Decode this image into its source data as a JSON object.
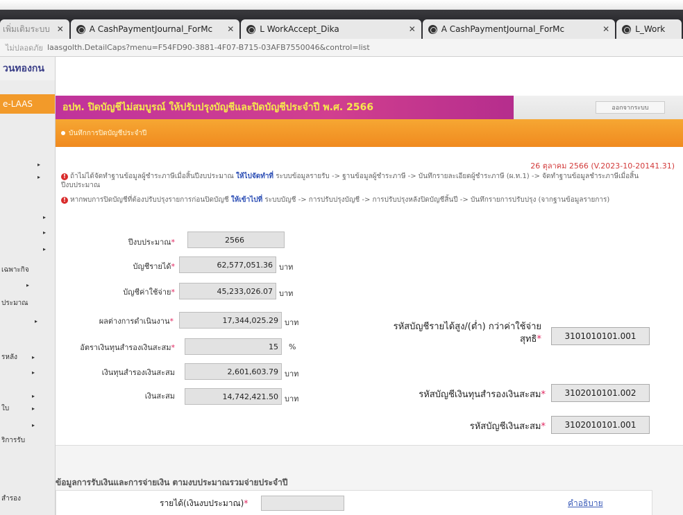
{
  "browser": {
    "tabs": [
      {
        "label": "",
        "width": 0
      },
      {
        "label": "A CashPaymentJournal_ForMc"
      },
      {
        "label": "L WorkAccept_Dika"
      },
      {
        "label": "A CashPaymentJournal_ForMc"
      },
      {
        "label": "L_Work"
      }
    ],
    "address": "laasgolth.DetailCaps?menu=F54FD90-3881-4F07-B715-03AFB7550046&control=list",
    "secure_label": "ไม่ปลอดภัย"
  },
  "sidebar": {
    "brand": "วนทองกน",
    "laas": "e-LAAS",
    "items": [
      "",
      "",
      "",
      "",
      "",
      "เฉพาะกิจ",
      "",
      "ประมาณ",
      "",
      "รหลัง",
      "",
      "",
      "ใบ",
      "",
      "ริการรับ",
      "สำรอง"
    ]
  },
  "page": {
    "title": "อปท. ปิดบัญชีไม่สมบูรณ์ ให้ปรับปรุงบัญชีและปิดบัญชีประจำปี พ.ศ. 2566",
    "back_button": "ออกจากระบบ",
    "subtitle": "บันทึกการปิดบัญชีประจำปี",
    "datestamp": "26 ตุลาคม 2566 (V.2023-10-20141.31)",
    "notice1_a": "ถ้าไม่ได้จัดทำฐานข้อมูลผู้ชำระภาษีเมื่อสิ้นปีงบประมาณ",
    "notice1_hl": "ให้ไปจัดทำที่",
    "notice1_b": "ระบบข้อมูลรายรับ -> ฐานข้อมูลผู้ชำระภาษี -> บันทึกรายละเอียดผู้ชำระภาษี (ผ.ท.1) -> จัดทำฐานข้อมูลชำระภาษีเมื่อสิ้นปีงบประมาณ",
    "notice2_a": "หากพบการปิดบัญชีที่ต้องปรับปรุงรายการก่อนปิดบัญชี",
    "notice2_hl": "ให้เข้าไปที่",
    "notice2_b": "ระบบบัญชี -> การปรับปรุงบัญชี -> การปรับปรุงหลังปิดบัญชีสิ้นปี -> บันทึกรายการปรับปรุง (จากฐานข้อมูลรายการ)",
    "unit_baht": "บาท",
    "unit_percent": "%"
  },
  "form": {
    "fiscal_year_label": "ปีงบประมาณ",
    "fiscal_year": "2566",
    "income_label": "บัญชีรายได้",
    "income": "62,577,051.36",
    "expense_label": "บัญชีค่าใช้จ่าย",
    "expense": "45,233,026.07",
    "diff_label": "ผลต่างการดำเนินงาน",
    "diff": "17,344,025.29",
    "rate_label": "อัตราเงินทุนสำรองเงินสะสม",
    "rate": "15",
    "reserve_label": "เงินทุนสำรองเงินสะสม",
    "reserve": "2,601,603.79",
    "accum_label": "เงินสะสม",
    "accum": "14,742,421.50"
  },
  "accounts": {
    "net_label_1": "รหัสบัญชีรายได้สูง/(ต่ำ) กว่าค่าใช้จ่าย",
    "net_label_2": "สุทธิ",
    "net_code": "3101010101.001",
    "reserve_label": "รหัสบัญชีเงินทุนสำรองเงินสะสม",
    "reserve_code": "3102010101.002",
    "accum_label": "รหัสบัญชีเงินสะสม",
    "accum_code": "3102010101.001"
  },
  "panel": {
    "title": "ข้อมูลการรับเงินและการจ่ายเงิน ตามงบประมาณรวมจ่ายประจำปี",
    "income_label": "รายได้(เงินงบประมาณ)",
    "desc_link": "คำอธิบาย"
  }
}
